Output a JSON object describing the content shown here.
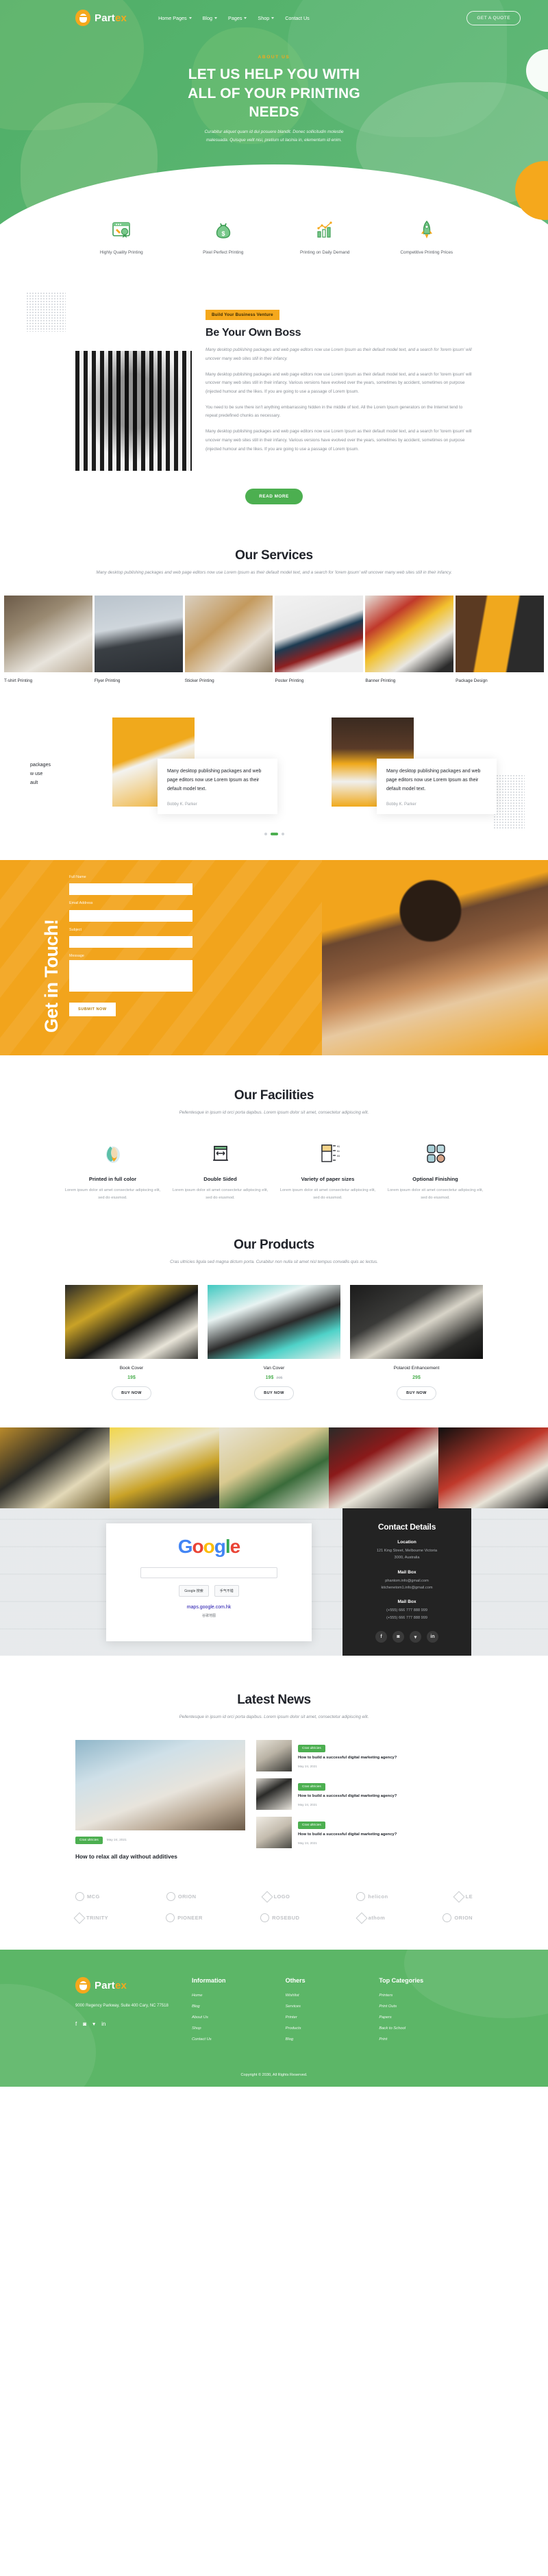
{
  "brand": {
    "name_main": "Part",
    "name_accent": "ex",
    "icon": "egg-logo-icon"
  },
  "nav": {
    "items": [
      {
        "label": "Home Pages",
        "has_caret": true
      },
      {
        "label": "Blog",
        "has_caret": true
      },
      {
        "label": "Pages",
        "has_caret": true
      },
      {
        "label": "Shop",
        "has_caret": true
      },
      {
        "label": "Contact Us",
        "has_caret": false
      }
    ],
    "cta": "GET A QUOTE"
  },
  "hero": {
    "eyebrow": "ABOUT US",
    "title_l1": "LET US HELP YOU WITH",
    "title_l2": "ALL OF YOUR PRINTING",
    "title_l3": "NEEDS",
    "sub_l1": "Curabitur aliquet quam id dui posuere blandit. Donec sollicitudin molestie",
    "sub_l2": "malesuada. Quisque velit nisi, pretium ut lacinia in, elementum id enim."
  },
  "features": [
    {
      "icon": "quality-badge-icon",
      "label": "Highly Quality Printing"
    },
    {
      "icon": "money-bag-icon",
      "label": "Pixel Perfect Printing"
    },
    {
      "icon": "growth-chart-icon",
      "label": "Printing on Daily Demand"
    },
    {
      "icon": "rocket-icon",
      "label": "Competitive Printing Prices"
    }
  ],
  "boss": {
    "tag": "Build Your Business Venture",
    "title": "Be Your Own Boss",
    "intro": "Many desktop publishing packages and web page editors now use Lorem Ipsum as their default model text, and a search for 'lorem ipsum' will uncover many web sites still in their infancy.",
    "p1": "Many desktop publishing packages and web page editors now use Lorem Ipsum as their default model text, and a search for 'lorem ipsum' will uncover many web sites still in their infancy. Various versions have evolved over the years, sometimes by accident, sometimes on purpose (injected humour and the likes. If you are going to use a passage of Lorem Ipsum.",
    "p2": "You need to be sure there isn't anything embarrassing hidden in the middle of text. All the Lorem Ipsum generators on the Internet tend to repeat predefined chunks as necessary.",
    "p3": "Many desktop publishing packages and web page editors now use Lorem Ipsum as their default model text, and a search for 'lorem ipsum' will uncover many web sites still in their infancy. Various versions have evolved over the years, sometimes by accident, sometimes on purpose (injected humour and the likes. If you are going to use a passage of Lorem Ipsum.",
    "read_more": "READ MORE"
  },
  "services": {
    "title": "Our Services",
    "subtitle": "Many desktop publishing packages and web page editors now use Lorem Ipsum as their default model text, and a search for 'lorem ipsum' will uncover many web sites still in their infancy.",
    "items": [
      {
        "name": "T-shirt Printing"
      },
      {
        "name": "Flyer Printing"
      },
      {
        "name": "Sticker Printing"
      },
      {
        "name": "Poster Printing"
      },
      {
        "name": "Banner Printing"
      },
      {
        "name": "Package Design"
      }
    ]
  },
  "testimonials": {
    "cut_text_l1": "packages",
    "cut_text_l2": "w use",
    "cut_text_l3": "ault",
    "items": [
      {
        "quote": "Many desktop publishing packages and web page editors now use Lorem Ipsum as their default model text.",
        "author": "Bobby K. Parker"
      },
      {
        "quote": "Many desktop publishing packages and web page editors now use Lorem Ipsum as their default model text.",
        "author": "Bobby K. Parker"
      }
    ]
  },
  "contact_form": {
    "title": "Get in Touch!",
    "fields": [
      {
        "label": "Full Name",
        "value": "",
        "placeholder": ""
      },
      {
        "label": "Email Address",
        "value": "",
        "placeholder": ""
      },
      {
        "label": "Subject",
        "value": "",
        "placeholder": ""
      },
      {
        "label": "Message",
        "value": "",
        "placeholder": ""
      }
    ],
    "submit": "SUBMIT NOW"
  },
  "facilities": {
    "title": "Our Facilities",
    "subtitle": "Pellentesque in ipsum id orci porta dapibus. Lorem ipsum dolor sit amet, consectetur adipiscing elit.",
    "items": [
      {
        "icon": "color-drop-icon",
        "name": "Printed in full color",
        "desc": "Lorem ipsum dolor sit amet consectetur adipiscing elit, sed do eiusmod."
      },
      {
        "icon": "double-sided-icon",
        "name": "Double Sided",
        "desc": "Lorem ipsum dolor sit amet consectetur adipiscing elit, sed do eiusmod."
      },
      {
        "icon": "paper-sizes-icon",
        "name": "Variety of paper sizes",
        "desc": "Lorem ipsum dolor sit amet consectetur adipiscing elit, sed do eiusmod."
      },
      {
        "icon": "finishing-grid-icon",
        "name": "Optional Finishing",
        "desc": "Lorem ipsum dolor sit amet consectetur adipiscing elit, sed do eiusmod."
      }
    ]
  },
  "products": {
    "title": "Our Products",
    "subtitle": "Cras ultricies ligula sed magna dictum porta. Curabitur non nulla sit amet nisl tempus convallis quis ac lectus.",
    "items": [
      {
        "name": "Book Cover",
        "price": "19$",
        "old_price": "",
        "buy": "BUY NOW"
      },
      {
        "name": "Van Cover",
        "price": "19$",
        "old_price": "20$",
        "buy": "BUY NOW"
      },
      {
        "name": "Polaroid Enhancement",
        "price": "29$",
        "old_price": "",
        "buy": "BUY NOW"
      }
    ]
  },
  "map": {
    "logo_g1": "G",
    "logo_o1": "o",
    "logo_o2": "o",
    "logo_g2": "g",
    "logo_l": "l",
    "logo_e": "e",
    "btn_1": "Google 搜索",
    "btn_2": "手气不错",
    "link": "maps.google.com.hk",
    "small": "谷歌地图"
  },
  "contact_details": {
    "title": "Contact Details",
    "blocks": [
      {
        "heading": "Location",
        "line1": "121 King Street, Melbourne Victoria",
        "line2": "3000, Australia"
      },
      {
        "heading": "Mail Box",
        "line1": "phantom.info@gmail.com",
        "line2": "kitchenetom1.info@gmail.com"
      },
      {
        "heading": "Mail Box",
        "line1": "(+555) 666 777 888 999",
        "line2": "(+555) 666 777 888 999"
      }
    ],
    "social": [
      {
        "icon": "facebook-icon",
        "glyph": "f"
      },
      {
        "icon": "instagram-icon",
        "glyph": "◙"
      },
      {
        "icon": "twitter-icon",
        "glyph": "▾"
      },
      {
        "icon": "linkedin-icon",
        "glyph": "in"
      }
    ]
  },
  "news": {
    "title": "Latest News",
    "subtitle": "Pellentesque in ipsum id orci porta dapibus. Lorem ipsum dolor sit amet, consectetur adipiscing elit.",
    "featured": {
      "tag": "Cras ultricies",
      "date": "May 24, 2021",
      "title": "How to relax all day without additives"
    },
    "items": [
      {
        "tag": "Cras ultricies",
        "date": "May 24, 2021",
        "title": "How to build a successful digital marketing agency?"
      },
      {
        "tag": "Cras ultricies",
        "date": "May 24, 2021",
        "title": "How to build a successful digital marketing agency?"
      },
      {
        "tag": "Cras ultricies",
        "date": "May 24, 2021",
        "title": "How to build a successful digital marketing agency?"
      }
    ]
  },
  "logos": {
    "row1": [
      "MCG",
      "ORION",
      "LOGO",
      "helicon",
      "LE"
    ],
    "row2": [
      "TRINITY",
      "PIONEER",
      "ROSEBUD",
      "athom",
      "ORION"
    ]
  },
  "footer": {
    "address": "9000 Regency Parkway, Suite 400 Cary, NC 77518",
    "social": [
      {
        "icon": "facebook-icon",
        "glyph": "f"
      },
      {
        "icon": "instagram-icon",
        "glyph": "◙"
      },
      {
        "icon": "twitter-icon",
        "glyph": "▾"
      },
      {
        "icon": "linkedin-icon",
        "glyph": "in"
      }
    ],
    "columns": [
      {
        "heading": "Information",
        "links": [
          "Home",
          "Blog",
          "About Us",
          "Shop",
          "Contact Us"
        ]
      },
      {
        "heading": "Others",
        "links": [
          "Wishlist",
          "Services",
          "Printer",
          "Products",
          "Blog"
        ]
      },
      {
        "heading": "Top Categories",
        "links": [
          "Printers",
          "Print Outs",
          "Papers",
          "Back to School",
          "Print"
        ]
      }
    ],
    "copyright": "Copyright © 2030, All Rights Reserved."
  },
  "colors": {
    "green": "#4caf50",
    "hero_green": "#56b36d",
    "footer_green": "#5cb667",
    "orange": "#f5a81c",
    "dark": "#232323"
  }
}
